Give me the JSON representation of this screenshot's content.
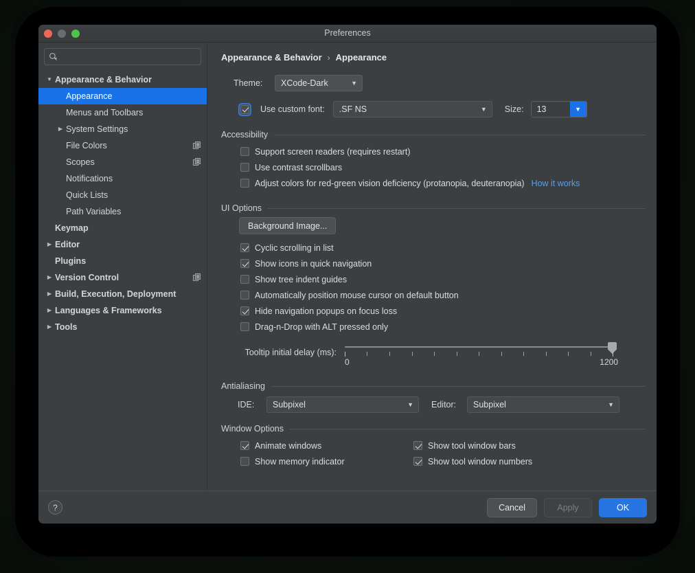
{
  "window": {
    "title": "Preferences",
    "traffic_lights": [
      "close",
      "minimize",
      "zoom"
    ]
  },
  "sidebar": {
    "search_placeholder": "",
    "search_value": "",
    "items": [
      {
        "label": "Appearance & Behavior",
        "indent": 0,
        "arrow": "▼",
        "bold": true,
        "selected": false,
        "copy_icon": false
      },
      {
        "label": "Appearance",
        "indent": 1,
        "arrow": "",
        "bold": false,
        "selected": true,
        "copy_icon": false
      },
      {
        "label": "Menus and Toolbars",
        "indent": 1,
        "arrow": "",
        "bold": false,
        "selected": false,
        "copy_icon": false
      },
      {
        "label": "System Settings",
        "indent": 1,
        "arrow": "▶",
        "bold": false,
        "selected": false,
        "copy_icon": false
      },
      {
        "label": "File Colors",
        "indent": 1,
        "arrow": "",
        "bold": false,
        "selected": false,
        "copy_icon": true
      },
      {
        "label": "Scopes",
        "indent": 1,
        "arrow": "",
        "bold": false,
        "selected": false,
        "copy_icon": true
      },
      {
        "label": "Notifications",
        "indent": 1,
        "arrow": "",
        "bold": false,
        "selected": false,
        "copy_icon": false
      },
      {
        "label": "Quick Lists",
        "indent": 1,
        "arrow": "",
        "bold": false,
        "selected": false,
        "copy_icon": false
      },
      {
        "label": "Path Variables",
        "indent": 1,
        "arrow": "",
        "bold": false,
        "selected": false,
        "copy_icon": false
      },
      {
        "label": "Keymap",
        "indent": 0,
        "arrow": "",
        "bold": true,
        "selected": false,
        "copy_icon": false
      },
      {
        "label": "Editor",
        "indent": 0,
        "arrow": "▶",
        "bold": true,
        "selected": false,
        "copy_icon": false
      },
      {
        "label": "Plugins",
        "indent": 0,
        "arrow": "",
        "bold": true,
        "selected": false,
        "copy_icon": false
      },
      {
        "label": "Version Control",
        "indent": 0,
        "arrow": "▶",
        "bold": true,
        "selected": false,
        "copy_icon": true
      },
      {
        "label": "Build, Execution, Deployment",
        "indent": 0,
        "arrow": "▶",
        "bold": true,
        "selected": false,
        "copy_icon": false
      },
      {
        "label": "Languages & Frameworks",
        "indent": 0,
        "arrow": "▶",
        "bold": true,
        "selected": false,
        "copy_icon": false
      },
      {
        "label": "Tools",
        "indent": 0,
        "arrow": "▶",
        "bold": true,
        "selected": false,
        "copy_icon": false
      }
    ]
  },
  "main": {
    "breadcrumb": {
      "root": "Appearance & Behavior",
      "separator": "›",
      "leaf": "Appearance"
    },
    "theme": {
      "label": "Theme:",
      "value": "XCode-Dark",
      "caret": "▼"
    },
    "custom_font": {
      "checkbox_label": "Use custom font:",
      "checked": true,
      "focused": true,
      "font_value": ".SF NS",
      "caret": "▼",
      "size_label": "Size:",
      "size_value": "13",
      "size_caret": "▼"
    },
    "accessibility": {
      "title": "Accessibility",
      "options": [
        {
          "label": "Support screen readers (requires restart)",
          "checked": false,
          "link": ""
        },
        {
          "label": "Use contrast scrollbars",
          "checked": false,
          "link": ""
        },
        {
          "label": "Adjust colors for red-green vision deficiency (protanopia, deuteranopia)",
          "checked": false,
          "link": "How it works"
        }
      ]
    },
    "ui_options": {
      "title": "UI Options",
      "background_image_button": "Background Image...",
      "options": [
        {
          "label": "Cyclic scrolling in list",
          "checked": true
        },
        {
          "label": "Show icons in quick navigation",
          "checked": true
        },
        {
          "label": "Show tree indent guides",
          "checked": false
        },
        {
          "label": "Automatically position mouse cursor on default button",
          "checked": false
        },
        {
          "label": "Hide navigation popups on focus loss",
          "checked": true
        },
        {
          "label": "Drag-n-Drop with ALT pressed only",
          "checked": false
        }
      ],
      "tooltip_slider": {
        "label": "Tooltip initial delay (ms):",
        "min": "0",
        "max": "1200",
        "value": "1200",
        "tick_count": 13
      }
    },
    "antialiasing": {
      "title": "Antialiasing",
      "ide_label": "IDE:",
      "ide_value": "Subpixel",
      "editor_label": "Editor:",
      "editor_value": "Subpixel",
      "caret": "▼"
    },
    "window_options": {
      "title": "Window Options",
      "left_column": [
        {
          "label": "Animate windows",
          "checked": true
        },
        {
          "label": "Show memory indicator",
          "checked": false
        }
      ],
      "right_column": [
        {
          "label": "Show tool window bars",
          "checked": true
        },
        {
          "label": "Show tool window numbers",
          "checked": true
        }
      ]
    }
  },
  "footer": {
    "help": "?",
    "cancel": "Cancel",
    "apply": "Apply",
    "ok": "OK"
  },
  "colors": {
    "accent_blue": "#1a72e8",
    "primary_button": "#2675e0",
    "link_blue": "#5b9fe8",
    "panel_bg": "#3c3f41",
    "selection_bg": "#1a72e8"
  }
}
